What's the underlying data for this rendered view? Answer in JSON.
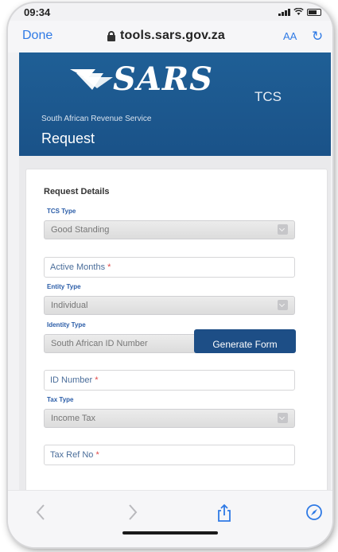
{
  "status_bar": {
    "time": "09:34"
  },
  "browser": {
    "done_label": "Done",
    "url": "tools.sars.gov.za",
    "text_size_label": "AA"
  },
  "header": {
    "logo_text": "SARS",
    "app_label": "TCS",
    "agency_name": "South African Revenue Service",
    "page_title": "Request"
  },
  "form": {
    "section_title": "Request Details",
    "tcs_type": {
      "label": "TCS Type",
      "value": "Good Standing"
    },
    "active_months": {
      "placeholder": "Active Months",
      "required_mark": "*"
    },
    "entity_type": {
      "label": "Entity Type",
      "value": "Individual"
    },
    "identity_type": {
      "label": "Identity Type",
      "value": "South African ID Number"
    },
    "id_number": {
      "placeholder": "ID Number",
      "required_mark": "*"
    },
    "tax_type": {
      "label": "Tax Type",
      "value": "Income Tax"
    },
    "tax_ref": {
      "placeholder": "Tax Ref No",
      "required_mark": "*"
    },
    "generate_button": "Generate Form"
  },
  "toolbar": {
    "back_icon": "chevron-left-icon",
    "forward_icon": "chevron-right-icon",
    "share_icon": "share-icon",
    "compass_icon": "compass-icon"
  },
  "colors": {
    "sars_blue": "#1f5f96",
    "link_blue": "#2f7ae5",
    "required_red": "#e04848"
  }
}
